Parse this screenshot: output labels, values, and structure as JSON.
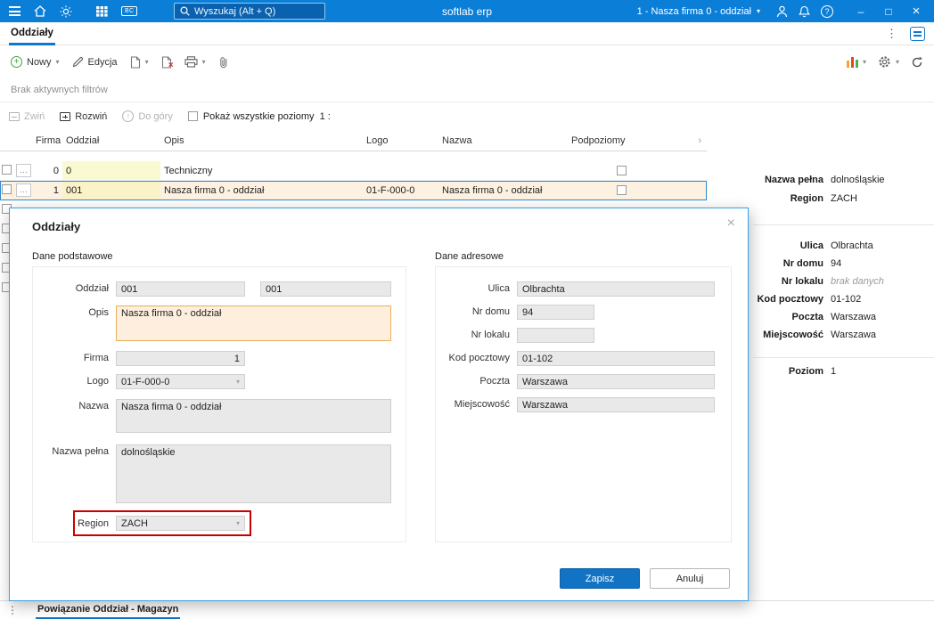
{
  "colors": {
    "topbar": "#0b7ed8",
    "accent": "#1177c8",
    "selection_bg": "#fdf2e2",
    "key_cell_bg": "#fafad2",
    "highlight_field_bg": "#fdeedd",
    "highlight_field_border": "#e8b05c",
    "annotation_red": "#c90000",
    "save_button": "#1273c4"
  },
  "icons": {
    "chevron_down": "▾",
    "more_vertical": "⋮",
    "row_more": "…",
    "minimize": "–",
    "maximize": "□",
    "close": "×",
    "help": "?",
    "up_arrow": "↑",
    "header_expander": "›",
    "bc_badge": "BC",
    "dialog_close": "×"
  },
  "topbar": {
    "search_placeholder": "Wyszukaj (Alt + Q)",
    "app_title": "softlab erp",
    "context": "1 - Nasza firma 0 - oddział"
  },
  "tabbar": {
    "active_tab": "Oddziały"
  },
  "toolbar": {
    "new": "Nowy",
    "edit": "Edycja"
  },
  "filterbar": {
    "text": "Brak aktywnych filtrów"
  },
  "treebar": {
    "collapse": "Zwiń",
    "expand": "Rozwiń",
    "to_top": "Do góry",
    "show_levels": "Pokaż wszystkie poziomy",
    "level": "1 :"
  },
  "table": {
    "columns": {
      "firma": "Firma",
      "oddzial": "Oddział",
      "opis": "Opis",
      "logo": "Logo",
      "nazwa": "Nazwa",
      "podpoziomy": "Podpoziomy"
    },
    "rows": [
      {
        "firma": "0",
        "oddzial": "0",
        "opis": "Techniczny",
        "logo": "",
        "nazwa": ""
      },
      {
        "firma": "1",
        "oddzial": "001",
        "opis": "Nasza firma 0 - oddział",
        "logo": "01-F-000-0",
        "nazwa": "Nasza firma 0 - oddział"
      }
    ]
  },
  "detail": {
    "nazwa_pelna": {
      "label": "Nazwa pełna",
      "value": "dolnośląskie"
    },
    "region": {
      "label": "Region",
      "value": "ZACH"
    },
    "ulica": {
      "label": "Ulica",
      "value": "Olbrachta"
    },
    "nr_domu": {
      "label": "Nr domu",
      "value": "94"
    },
    "nr_lokalu": {
      "label": "Nr lokalu",
      "value": "brak danych"
    },
    "kod_pocztowy": {
      "label": "Kod pocztowy",
      "value": "01-102"
    },
    "poczta": {
      "label": "Poczta",
      "value": "Warszawa"
    },
    "miejscowosc": {
      "label": "Miejscowość",
      "value": "Warszawa"
    },
    "poziom": {
      "label": "Poziom",
      "value": "1"
    }
  },
  "modal": {
    "title": "Oddziały",
    "basic": {
      "title": "Dane podstawowe",
      "oddzial_label": "Oddział",
      "oddzial_value1": "001",
      "oddzial_value2": "001",
      "opis_label": "Opis",
      "opis_value": "Nasza firma 0 - oddział",
      "firma_label": "Firma",
      "firma_value": "1",
      "logo_label": "Logo",
      "logo_value": "01-F-000-0",
      "nazwa_label": "Nazwa",
      "nazwa_value": "Nasza firma 0 - oddział",
      "nazwa_pelna_label": "Nazwa pełna",
      "nazwa_pelna_value": "dolnośląskie",
      "region_label": "Region",
      "region_value": "ZACH"
    },
    "address": {
      "title": "Dane adresowe",
      "ulica_label": "Ulica",
      "ulica_value": "Olbrachta",
      "nr_domu_label": "Nr domu",
      "nr_domu_value": "94",
      "nr_lokalu_label": "Nr lokalu",
      "nr_lokalu_value": "",
      "kod_label": "Kod pocztowy",
      "kod_value": "01-102",
      "poczta_label": "Poczta",
      "poczta_value": "Warszawa",
      "miejscowosc_label": "Miejscowość",
      "miejscowosc_value": "Warszawa"
    },
    "save": "Zapisz",
    "cancel": "Anuluj"
  },
  "bottombar": {
    "tab": "Powiązanie Oddział - Magazyn"
  }
}
